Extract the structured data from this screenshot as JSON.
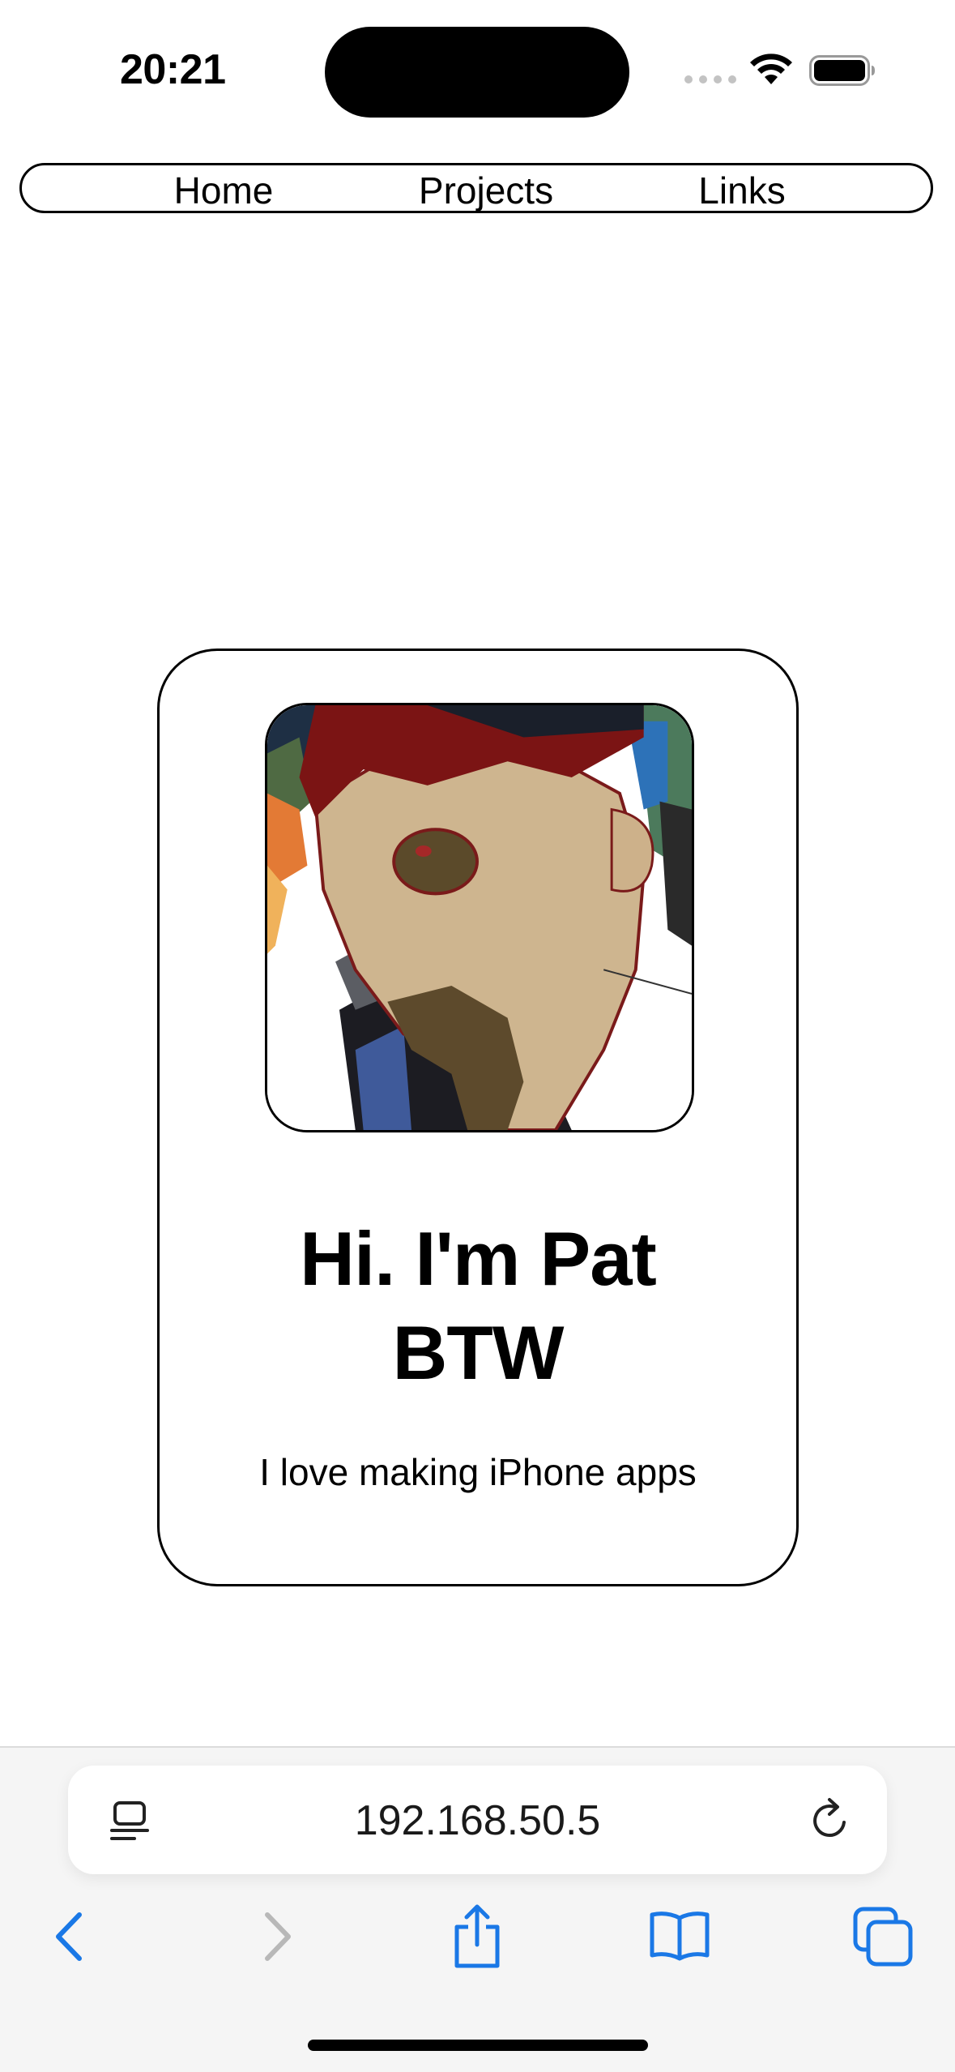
{
  "status_bar": {
    "time": "20:21"
  },
  "nav": {
    "items": [
      {
        "label": "Home"
      },
      {
        "label": "Projects"
      },
      {
        "label": "Links"
      }
    ]
  },
  "card": {
    "avatar_icon": "avatar-illustration",
    "heading_line1": "Hi. I'm Pat",
    "heading_line2": "BTW",
    "subtitle": "I love making iPhone apps"
  },
  "browser": {
    "address": "192.168.50.5",
    "accent_color": "#1a78e6",
    "toolbar": {
      "back_icon": "chevron-left-icon",
      "forward_icon": "chevron-right-icon",
      "share_icon": "share-icon",
      "bookmarks_icon": "book-icon",
      "tabs_icon": "tabs-icon"
    }
  }
}
